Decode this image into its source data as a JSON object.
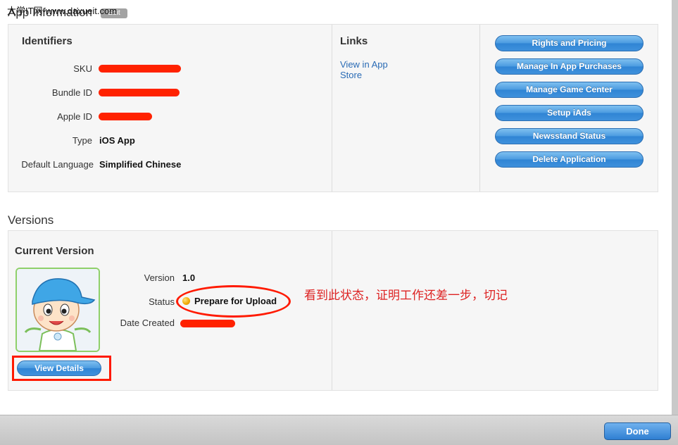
{
  "watermark": "大学IT网-www.daxueit.com",
  "app_information": {
    "title": "App Information",
    "edit_label": "Edit"
  },
  "identifiers": {
    "title": "Identifiers",
    "rows": [
      {
        "label": "SKU",
        "value": ""
      },
      {
        "label": "Bundle ID",
        "value": ""
      },
      {
        "label": "Apple ID",
        "value": ""
      },
      {
        "label": "Type",
        "value": "iOS App"
      },
      {
        "label": "Default Language",
        "value": "Simplified Chinese"
      }
    ]
  },
  "links": {
    "title": "Links",
    "view_in_app_store": "View in App Store"
  },
  "actions": [
    "Rights and Pricing",
    "Manage In App Purchases",
    "Manage Game Center",
    "Setup iAds",
    "Newsstand Status",
    "Delete Application"
  ],
  "versions": {
    "title": "Versions",
    "current_title": "Current Version",
    "version_label": "Version",
    "version_value": "1.0",
    "status_label": "Status",
    "status_value": "Prepare for Upload",
    "date_label": "Date Created",
    "view_details": "View Details"
  },
  "annotation": "看到此状态，证明工作还差一步，切记",
  "footer": {
    "done_label": "Done"
  },
  "colors": {
    "accent_blue": "#3f91dc",
    "annotation_red": "#ff1a00",
    "status_yellow": "#f0a800"
  }
}
